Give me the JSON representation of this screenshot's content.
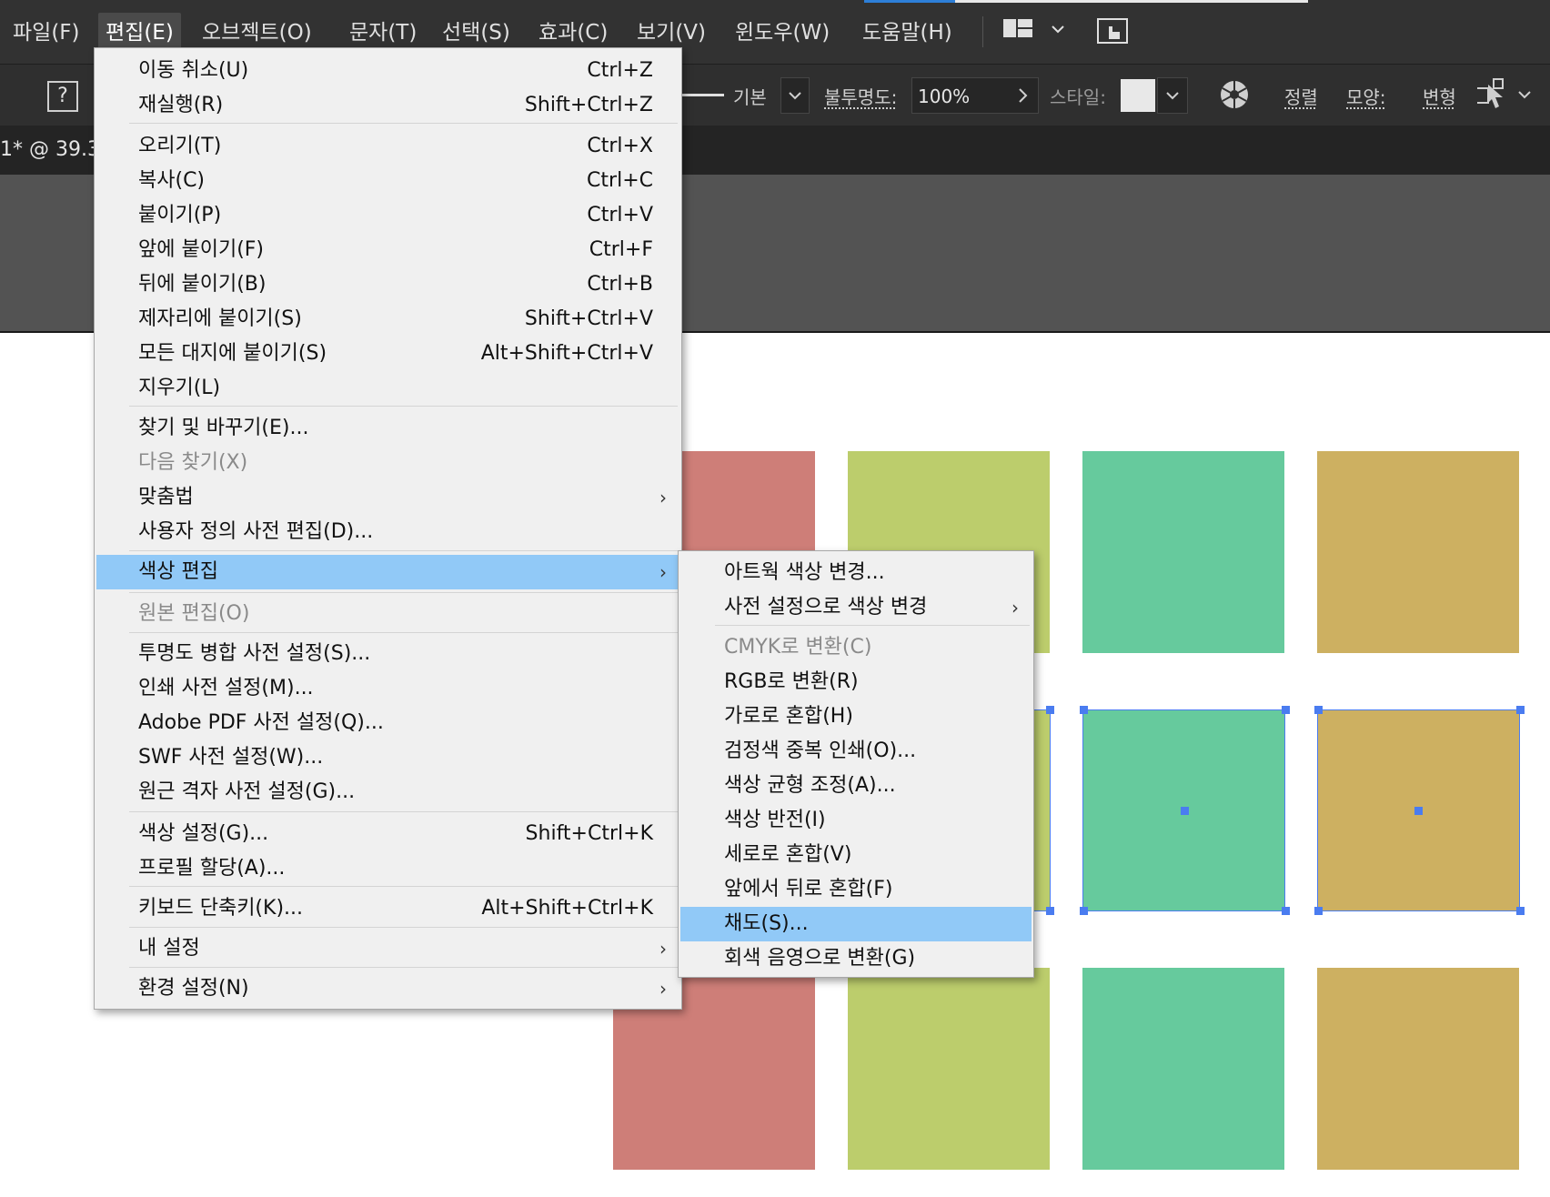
{
  "menubar": {
    "items": [
      {
        "label": "파일(F)"
      },
      {
        "label": "편집(E)"
      },
      {
        "label": "오브젝트(O)"
      },
      {
        "label": "문자(T)"
      },
      {
        "label": "선택(S)"
      },
      {
        "label": "효과(C)"
      },
      {
        "label": "보기(V)"
      },
      {
        "label": "윈도우(W)"
      },
      {
        "label": "도움말(H)"
      }
    ]
  },
  "controlbar": {
    "help_glyph": "?",
    "stroke_profile": "기본",
    "opacity_label": "불투명도:",
    "opacity_value": "100%",
    "style_label": "스타일:",
    "align_label": "정렬",
    "shape_label": "모양:",
    "transform_label": "변형"
  },
  "document": {
    "tab_title": "1* @ 39.3"
  },
  "edit_menu": {
    "items": [
      {
        "label": "이동 취소(U)",
        "shortcut": "Ctrl+Z"
      },
      {
        "label": "재실행(R)",
        "shortcut": "Shift+Ctrl+Z"
      },
      {
        "label": "오리기(T)",
        "shortcut": "Ctrl+X"
      },
      {
        "label": "복사(C)",
        "shortcut": "Ctrl+C"
      },
      {
        "label": "붙이기(P)",
        "shortcut": "Ctrl+V"
      },
      {
        "label": "앞에 붙이기(F)",
        "shortcut": "Ctrl+F"
      },
      {
        "label": "뒤에 붙이기(B)",
        "shortcut": "Ctrl+B"
      },
      {
        "label": "제자리에 붙이기(S)",
        "shortcut": "Shift+Ctrl+V"
      },
      {
        "label": "모든 대지에 붙이기(S)",
        "shortcut": "Alt+Shift+Ctrl+V"
      },
      {
        "label": "지우기(L)",
        "shortcut": ""
      },
      {
        "label": "찾기 및 바꾸기(E)...",
        "shortcut": ""
      },
      {
        "label": "다음 찾기(X)",
        "shortcut": ""
      },
      {
        "label": "맞춤법",
        "shortcut": ""
      },
      {
        "label": "사용자 정의 사전 편집(D)...",
        "shortcut": ""
      },
      {
        "label": "색상 편집",
        "shortcut": ""
      },
      {
        "label": "원본 편집(O)",
        "shortcut": ""
      },
      {
        "label": "투명도 병합 사전 설정(S)...",
        "shortcut": ""
      },
      {
        "label": "인쇄 사전 설정(M)...",
        "shortcut": ""
      },
      {
        "label": "Adobe PDF 사전 설정(Q)...",
        "shortcut": ""
      },
      {
        "label": "SWF 사전 설정(W)...",
        "shortcut": ""
      },
      {
        "label": "원근 격자 사전 설정(G)...",
        "shortcut": ""
      },
      {
        "label": "색상 설정(G)...",
        "shortcut": "Shift+Ctrl+K"
      },
      {
        "label": "프로필 할당(A)...",
        "shortcut": ""
      },
      {
        "label": "키보드 단축키(K)...",
        "shortcut": "Alt+Shift+Ctrl+K"
      },
      {
        "label": "내 설정",
        "shortcut": ""
      },
      {
        "label": "환경 설정(N)",
        "shortcut": ""
      }
    ]
  },
  "color_submenu": {
    "items": [
      {
        "label": "아트웍 색상 변경..."
      },
      {
        "label": "사전 설정으로 색상 변경"
      },
      {
        "label": "CMYK로 변환(C)"
      },
      {
        "label": "RGB로 변환(R)"
      },
      {
        "label": "가로로 혼합(H)"
      },
      {
        "label": "검정색 중복 인쇄(O)..."
      },
      {
        "label": "색상 균형 조정(A)..."
      },
      {
        "label": "색상 반전(I)"
      },
      {
        "label": "세로로 혼합(V)"
      },
      {
        "label": "앞에서 뒤로 혼합(F)"
      },
      {
        "label": "채도(S)..."
      },
      {
        "label": "회색 음영으로 변환(G)"
      }
    ]
  },
  "colors": {
    "red": "#ce7e78",
    "olive": "#bccd6c",
    "green": "#66ca9d",
    "gold": "#cdb061",
    "selection": "#4a7cf0",
    "menu_highlight": "#91c9f7"
  }
}
